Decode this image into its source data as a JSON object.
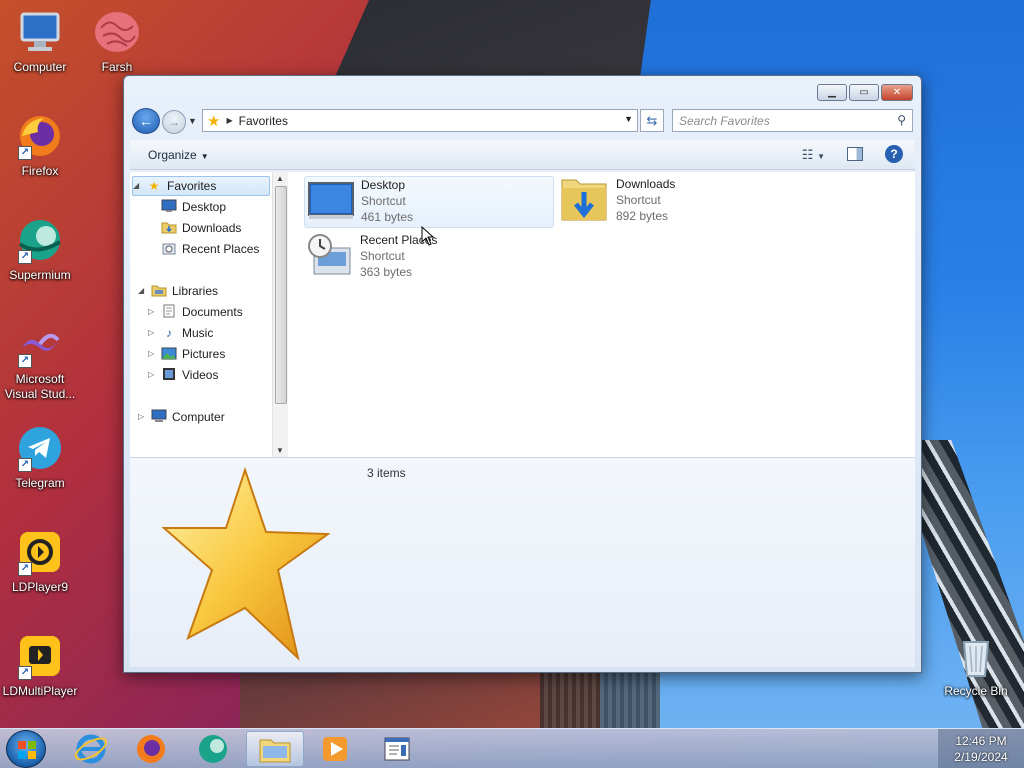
{
  "desktop": {
    "icons": [
      {
        "label": "Computer"
      },
      {
        "label": "Farsh"
      },
      {
        "label": "Firefox"
      },
      {
        "label": "Supermium"
      },
      {
        "label": "Microsoft Visual Stud..."
      },
      {
        "label": "Telegram"
      },
      {
        "label": "LDPlayer9"
      },
      {
        "label": "LDMultiPlayer"
      },
      {
        "label": "Recycle Bin"
      }
    ]
  },
  "window": {
    "address": "Favorites",
    "search_placeholder": "Search Favorites",
    "toolbar": {
      "organize": "Organize"
    },
    "nav": {
      "favorites": "Favorites",
      "desktop": "Desktop",
      "downloads": "Downloads",
      "recent_places": "Recent Places",
      "libraries": "Libraries",
      "documents": "Documents",
      "music": "Music",
      "pictures": "Pictures",
      "videos": "Videos",
      "computer": "Computer"
    },
    "files": [
      {
        "name": "Desktop",
        "type": "Shortcut",
        "size": "461 bytes"
      },
      {
        "name": "Downloads",
        "type": "Shortcut",
        "size": "892 bytes"
      },
      {
        "name": "Recent Places",
        "type": "Shortcut",
        "size": "363 bytes"
      }
    ],
    "details": {
      "count": "3 items"
    }
  },
  "taskbar": {
    "time": "12:46 PM",
    "date": "2/19/2024"
  },
  "colors": {
    "accent": "#1c5bb0",
    "selection": "#d3e6fa",
    "star": "#f2b400"
  }
}
